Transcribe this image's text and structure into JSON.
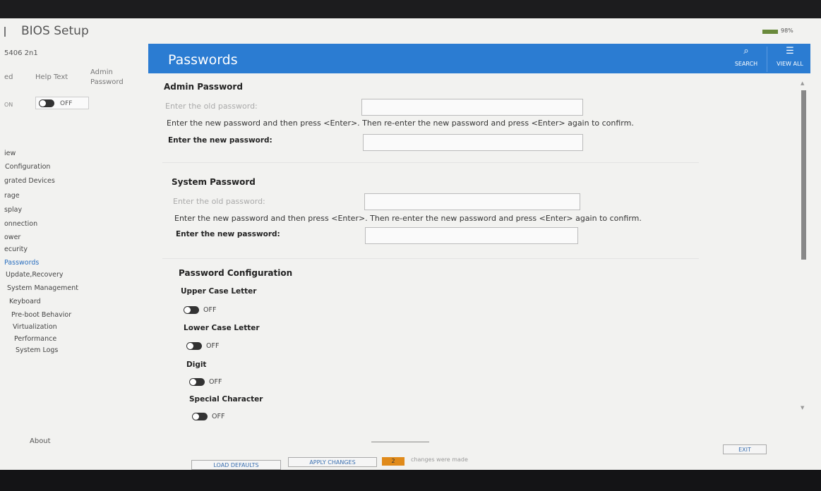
{
  "app": {
    "title": "BIOS Setup",
    "battery": "98%"
  },
  "sidebar": {
    "model": "5406 2n1",
    "columns": {
      "col1": "ed",
      "help_text": "Help Text",
      "admin_password": "Admin Password"
    },
    "on_label": "ON",
    "help_toggle_state": "OFF",
    "nav": [
      "iew",
      "Configuration",
      "grated Devices",
      "rage",
      "splay",
      "onnection",
      "ower",
      "ecurity",
      "Passwords",
      "Update,Recovery",
      "System Management",
      "Keyboard",
      "Pre-boot Behavior",
      "Virtualization",
      "Performance",
      "System Logs"
    ],
    "active_index": 8,
    "about": "About"
  },
  "header": {
    "title": "Passwords",
    "search": "SEARCH",
    "view_all": "VIEW ALL"
  },
  "admin": {
    "title": "Admin Password",
    "old_prompt": "Enter the old password:",
    "instructions": "Enter the new password and then press <Enter>. Then re-enter the new password and press <Enter> again to confirm.",
    "new_label": "Enter the new password:"
  },
  "system": {
    "title": "System Password",
    "old_prompt": "Enter the old password:",
    "instructions": "Enter the new password and then press <Enter>. Then re-enter the new password and press <Enter> again to confirm.",
    "new_label": "Enter the new password:"
  },
  "config": {
    "title": "Password Configuration",
    "items": [
      {
        "label": "Upper Case Letter",
        "state": "OFF"
      },
      {
        "label": "Lower Case Letter",
        "state": "OFF"
      },
      {
        "label": "Digit",
        "state": "OFF"
      },
      {
        "label": "Special Character",
        "state": "OFF"
      }
    ]
  },
  "footer": {
    "load_defaults": "LOAD DEFAULTS",
    "apply_changes": "APPLY CHANGES",
    "change_count": "2",
    "changes_text": "changes were made",
    "exit": "EXIT"
  },
  "colors": {
    "header": "#2b7cd2",
    "badge": "#e08a1a",
    "active_nav": "#2a6fbf"
  }
}
